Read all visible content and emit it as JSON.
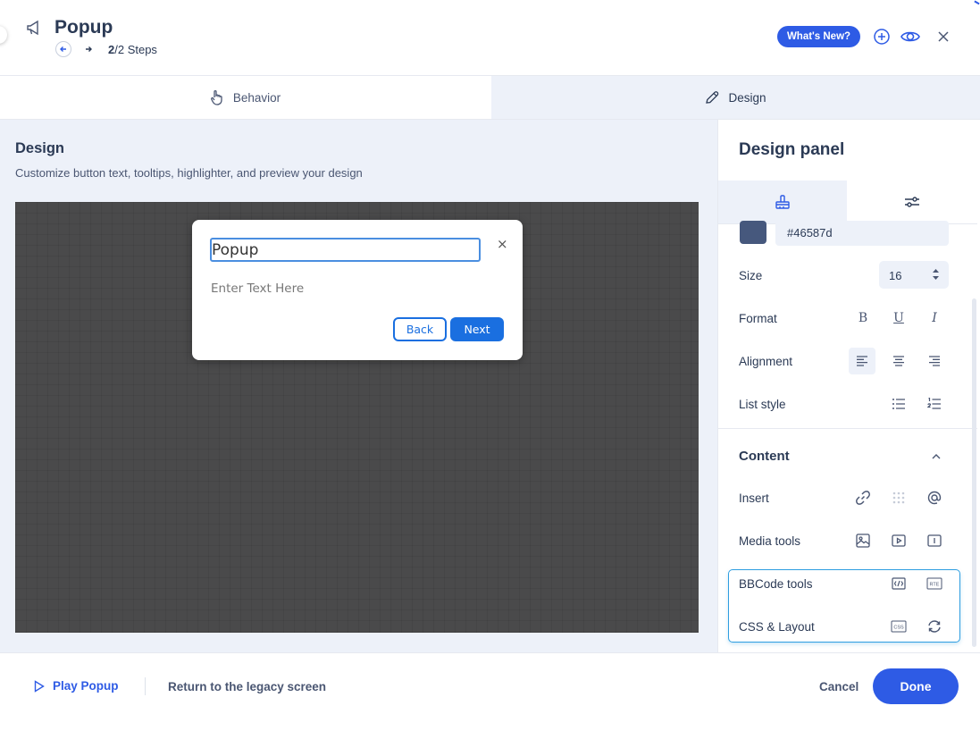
{
  "header": {
    "title": "Popup",
    "steps_current": "2",
    "steps_rest": "/2 Steps",
    "whats_new_label": "What's New?"
  },
  "tabs": [
    {
      "label": "Behavior",
      "icon": "hand-pointer-icon"
    },
    {
      "label": "Design",
      "icon": "pencil-icon"
    }
  ],
  "main": {
    "title": "Design",
    "subtitle": "Customize button text, tooltips, highlighter, and preview your design"
  },
  "preview": {
    "popup_title": "Popup",
    "popup_body": "Enter Text Here",
    "back_label": "Back",
    "next_label": "Next",
    "close_glyph": "×"
  },
  "panel": {
    "title": "Design panel",
    "color_hex": "#46587d",
    "size_label": "Size",
    "size_value": "16",
    "format_label": "Format",
    "alignment_label": "Alignment",
    "list_style_label": "List style",
    "content_title": "Content",
    "insert_label": "Insert",
    "media_label": "Media tools",
    "bbcode_label": "BBCode tools",
    "css_label": "CSS & Layout",
    "format_icons": [
      "B",
      "U",
      "I"
    ],
    "rte_text": "RTE",
    "css_text": "CSS"
  },
  "footer": {
    "play_label": "Play Popup",
    "legacy_label": "Return to the legacy screen",
    "cancel_label": "Cancel",
    "done_label": "Done"
  },
  "colors": {
    "accent": "#2e5be5",
    "popup_button": "#1a6fe0",
    "swatch": "#46587d",
    "panel_bg": "#edf1f9"
  }
}
